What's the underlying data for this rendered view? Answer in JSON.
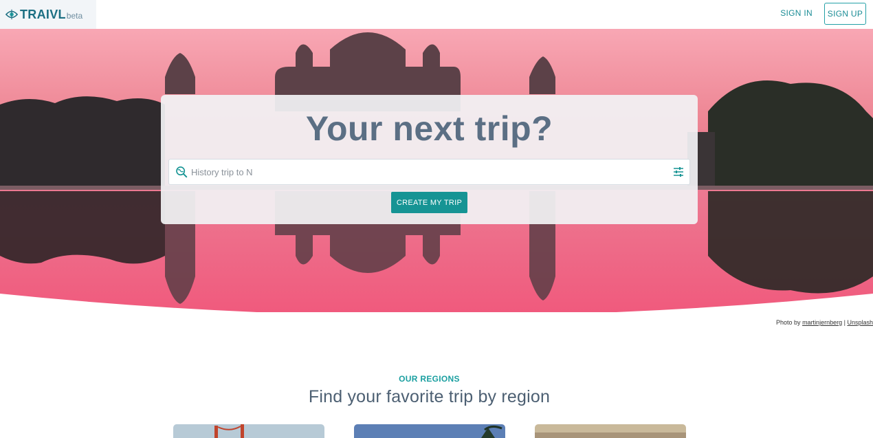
{
  "brand": {
    "name": "TRAIVL",
    "tag": "beta"
  },
  "nav": {
    "signin": "SIGN IN",
    "signup": "SIGN UP"
  },
  "hero": {
    "headline": "Your next trip?",
    "search_value": "History trip to N",
    "cta": "CREATE MY TRIP"
  },
  "credit": {
    "prefix": "Photo by",
    "author": "martinjernberg",
    "separator": "|",
    "source": "Unsplash"
  },
  "regions": {
    "eyebrow": "OUR REGIONS",
    "title": "Find your favorite trip by region"
  },
  "colors": {
    "accent": "#169494",
    "heading": "#5b6f84",
    "hero_pink": "#f27b93"
  },
  "icons": {
    "logo": "compass-eye-icon",
    "search": "search-globe-icon",
    "filter": "sliders-icon"
  }
}
